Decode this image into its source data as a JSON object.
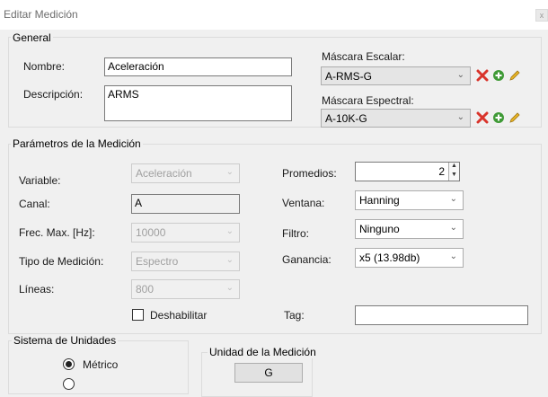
{
  "window": {
    "title": "Editar Medición",
    "close_glyph": "x"
  },
  "general": {
    "legend": "General",
    "nombre_label": "Nombre:",
    "nombre_value": "Aceleración",
    "descripcion_label": "Descripción:",
    "descripcion_value": "ARMS",
    "mascara_escalar_label": "Máscara Escalar:",
    "mascara_escalar_value": "A-RMS-G",
    "mascara_espectral_label": "Máscara Espectral:",
    "mascara_espectral_value": "A-10K-G"
  },
  "parametros": {
    "legend": "Parámetros de la Medición",
    "variable_label": "Variable:",
    "variable_value": "Aceleración",
    "canal_label": "Canal:",
    "canal_value": "A",
    "frec_label": "Frec. Max. [Hz]:",
    "frec_value": "10000",
    "tipo_label": "Tipo de Medición:",
    "tipo_value": "Espectro",
    "lineas_label": "Líneas:",
    "lineas_value": "800",
    "promedios_label": "Promedios:",
    "promedios_value": "2",
    "ventana_label": "Ventana:",
    "ventana_value": "Hanning",
    "filtro_label": "Filtro:",
    "filtro_value": "Ninguno",
    "ganancia_label": "Ganancia:",
    "ganancia_value": "x5 (13.98db)",
    "deshabilitar_label": "Deshabilitar",
    "tag_label": "Tag:",
    "tag_value": ""
  },
  "unidades": {
    "legend": "Sistema de Unidades",
    "metrico_label": "Métrico",
    "unidad_legend": "Unidad de la Medición",
    "unidad_value": "G"
  },
  "colors": {
    "delete_red": "#d9342b",
    "add_green": "#3f9a36",
    "edit_yellow": "#e8b424"
  }
}
